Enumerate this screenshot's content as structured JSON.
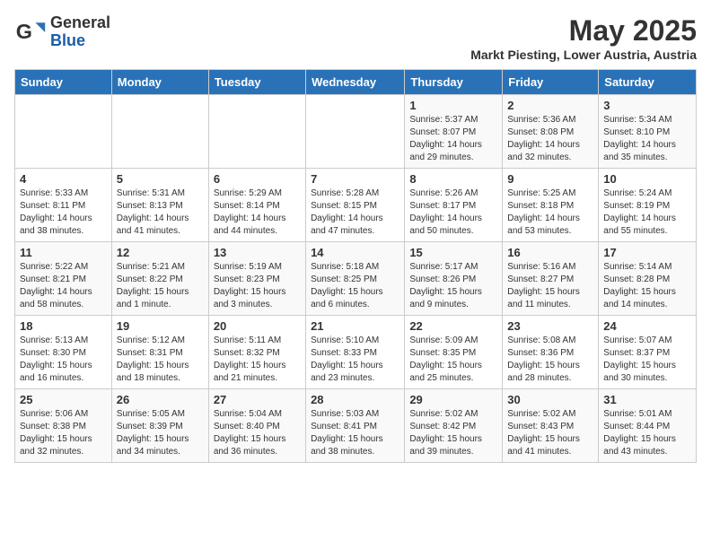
{
  "header": {
    "logo_general": "General",
    "logo_blue": "Blue",
    "month_year": "May 2025",
    "location": "Markt Piesting, Lower Austria, Austria"
  },
  "weekdays": [
    "Sunday",
    "Monday",
    "Tuesday",
    "Wednesday",
    "Thursday",
    "Friday",
    "Saturday"
  ],
  "weeks": [
    [
      {
        "day": "",
        "info": ""
      },
      {
        "day": "",
        "info": ""
      },
      {
        "day": "",
        "info": ""
      },
      {
        "day": "",
        "info": ""
      },
      {
        "day": "1",
        "info": "Sunrise: 5:37 AM\nSunset: 8:07 PM\nDaylight: 14 hours\nand 29 minutes."
      },
      {
        "day": "2",
        "info": "Sunrise: 5:36 AM\nSunset: 8:08 PM\nDaylight: 14 hours\nand 32 minutes."
      },
      {
        "day": "3",
        "info": "Sunrise: 5:34 AM\nSunset: 8:10 PM\nDaylight: 14 hours\nand 35 minutes."
      }
    ],
    [
      {
        "day": "4",
        "info": "Sunrise: 5:33 AM\nSunset: 8:11 PM\nDaylight: 14 hours\nand 38 minutes."
      },
      {
        "day": "5",
        "info": "Sunrise: 5:31 AM\nSunset: 8:13 PM\nDaylight: 14 hours\nand 41 minutes."
      },
      {
        "day": "6",
        "info": "Sunrise: 5:29 AM\nSunset: 8:14 PM\nDaylight: 14 hours\nand 44 minutes."
      },
      {
        "day": "7",
        "info": "Sunrise: 5:28 AM\nSunset: 8:15 PM\nDaylight: 14 hours\nand 47 minutes."
      },
      {
        "day": "8",
        "info": "Sunrise: 5:26 AM\nSunset: 8:17 PM\nDaylight: 14 hours\nand 50 minutes."
      },
      {
        "day": "9",
        "info": "Sunrise: 5:25 AM\nSunset: 8:18 PM\nDaylight: 14 hours\nand 53 minutes."
      },
      {
        "day": "10",
        "info": "Sunrise: 5:24 AM\nSunset: 8:19 PM\nDaylight: 14 hours\nand 55 minutes."
      }
    ],
    [
      {
        "day": "11",
        "info": "Sunrise: 5:22 AM\nSunset: 8:21 PM\nDaylight: 14 hours\nand 58 minutes."
      },
      {
        "day": "12",
        "info": "Sunrise: 5:21 AM\nSunset: 8:22 PM\nDaylight: 15 hours\nand 1 minute."
      },
      {
        "day": "13",
        "info": "Sunrise: 5:19 AM\nSunset: 8:23 PM\nDaylight: 15 hours\nand 3 minutes."
      },
      {
        "day": "14",
        "info": "Sunrise: 5:18 AM\nSunset: 8:25 PM\nDaylight: 15 hours\nand 6 minutes."
      },
      {
        "day": "15",
        "info": "Sunrise: 5:17 AM\nSunset: 8:26 PM\nDaylight: 15 hours\nand 9 minutes."
      },
      {
        "day": "16",
        "info": "Sunrise: 5:16 AM\nSunset: 8:27 PM\nDaylight: 15 hours\nand 11 minutes."
      },
      {
        "day": "17",
        "info": "Sunrise: 5:14 AM\nSunset: 8:28 PM\nDaylight: 15 hours\nand 14 minutes."
      }
    ],
    [
      {
        "day": "18",
        "info": "Sunrise: 5:13 AM\nSunset: 8:30 PM\nDaylight: 15 hours\nand 16 minutes."
      },
      {
        "day": "19",
        "info": "Sunrise: 5:12 AM\nSunset: 8:31 PM\nDaylight: 15 hours\nand 18 minutes."
      },
      {
        "day": "20",
        "info": "Sunrise: 5:11 AM\nSunset: 8:32 PM\nDaylight: 15 hours\nand 21 minutes."
      },
      {
        "day": "21",
        "info": "Sunrise: 5:10 AM\nSunset: 8:33 PM\nDaylight: 15 hours\nand 23 minutes."
      },
      {
        "day": "22",
        "info": "Sunrise: 5:09 AM\nSunset: 8:35 PM\nDaylight: 15 hours\nand 25 minutes."
      },
      {
        "day": "23",
        "info": "Sunrise: 5:08 AM\nSunset: 8:36 PM\nDaylight: 15 hours\nand 28 minutes."
      },
      {
        "day": "24",
        "info": "Sunrise: 5:07 AM\nSunset: 8:37 PM\nDaylight: 15 hours\nand 30 minutes."
      }
    ],
    [
      {
        "day": "25",
        "info": "Sunrise: 5:06 AM\nSunset: 8:38 PM\nDaylight: 15 hours\nand 32 minutes."
      },
      {
        "day": "26",
        "info": "Sunrise: 5:05 AM\nSunset: 8:39 PM\nDaylight: 15 hours\nand 34 minutes."
      },
      {
        "day": "27",
        "info": "Sunrise: 5:04 AM\nSunset: 8:40 PM\nDaylight: 15 hours\nand 36 minutes."
      },
      {
        "day": "28",
        "info": "Sunrise: 5:03 AM\nSunset: 8:41 PM\nDaylight: 15 hours\nand 38 minutes."
      },
      {
        "day": "29",
        "info": "Sunrise: 5:02 AM\nSunset: 8:42 PM\nDaylight: 15 hours\nand 39 minutes."
      },
      {
        "day": "30",
        "info": "Sunrise: 5:02 AM\nSunset: 8:43 PM\nDaylight: 15 hours\nand 41 minutes."
      },
      {
        "day": "31",
        "info": "Sunrise: 5:01 AM\nSunset: 8:44 PM\nDaylight: 15 hours\nand 43 minutes."
      }
    ]
  ]
}
